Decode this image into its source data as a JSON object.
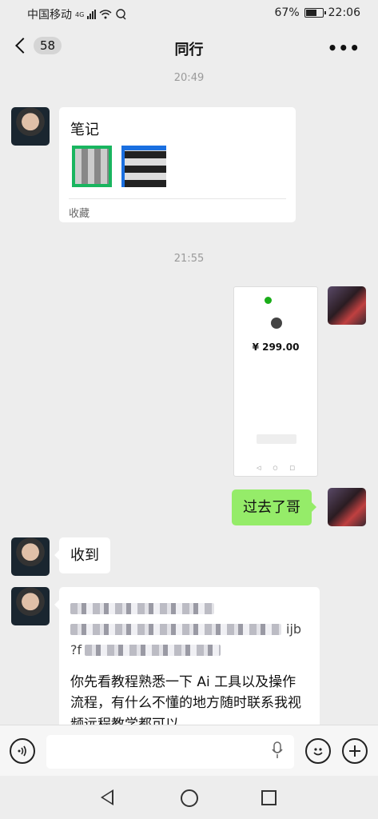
{
  "status_bar": {
    "carrier": "中国移动",
    "network": "4G",
    "battery": "67%",
    "battery_level": 0.67,
    "time": "22:06"
  },
  "header": {
    "back_count": "58",
    "title": "同行",
    "more": "•••"
  },
  "messages": {
    "time1": "20:49",
    "note_title": "笔记",
    "note_footer": "收藏",
    "time2": "21:55",
    "screenshot_amount": "¥ 299.00",
    "outgoing_text": "过去了哥",
    "incoming_ack": "收到",
    "link_fragment_1": "ijb",
    "link_fragment_2": "?f",
    "long_text": "你先看教程熟悉一下 Ai 工具以及操作流程，有什么不懂的地方随时联系我视频远程教学都可以"
  },
  "input_bar": {
    "placeholder": ""
  },
  "icons": {
    "back": "chevron-left-icon",
    "more": "more-icon",
    "voice": "voice-icon",
    "mic": "microphone-icon",
    "emoji": "emoji-icon",
    "add": "plus-icon"
  }
}
